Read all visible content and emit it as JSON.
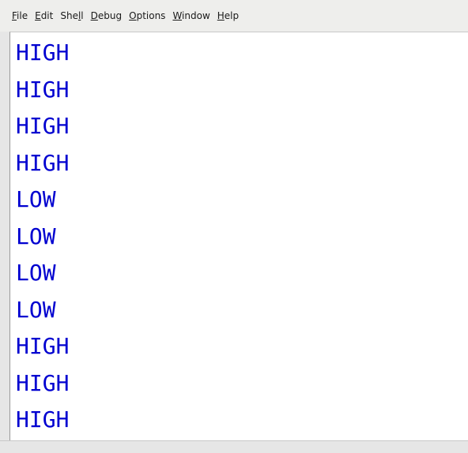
{
  "menu": [
    {
      "pre": "",
      "mn": "F",
      "post": "ile"
    },
    {
      "pre": "",
      "mn": "E",
      "post": "dit"
    },
    {
      "pre": "She",
      "mn": "l",
      "post": "l"
    },
    {
      "pre": "",
      "mn": "D",
      "post": "ebug"
    },
    {
      "pre": "",
      "mn": "O",
      "post": "ptions"
    },
    {
      "pre": "",
      "mn": "W",
      "post": "indow"
    },
    {
      "pre": "",
      "mn": "H",
      "post": "elp"
    }
  ],
  "output": [
    "HIGH",
    "HIGH",
    "HIGH",
    "HIGH",
    "LOW",
    "LOW",
    "LOW",
    "LOW",
    "HIGH",
    "HIGH",
    "HIGH"
  ],
  "colors": {
    "output_text": "#0000d0",
    "menubar_bg": "#eeeeec",
    "shell_bg": "#ffffff"
  }
}
